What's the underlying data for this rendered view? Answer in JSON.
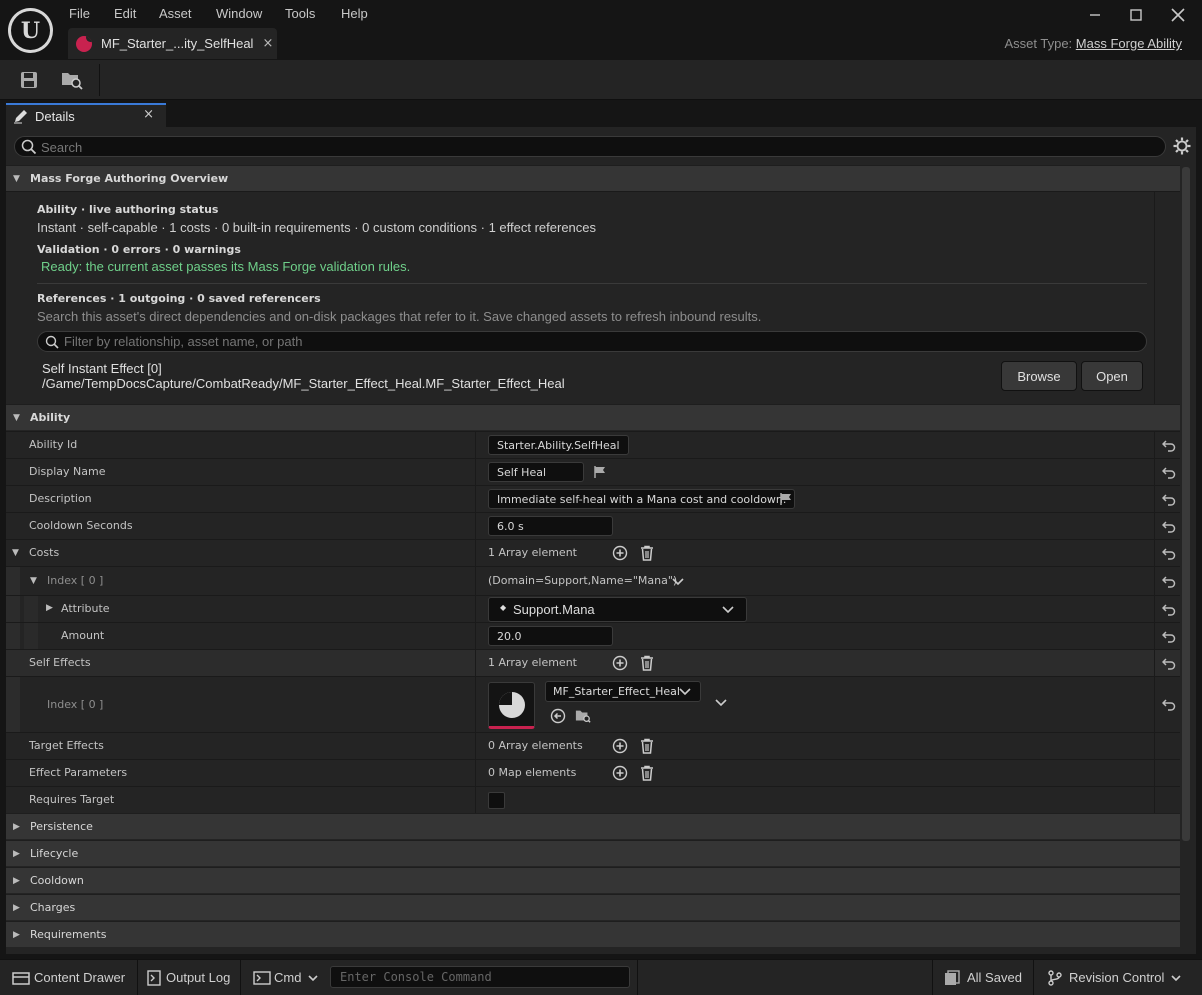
{
  "menu": {
    "file": "File",
    "edit": "Edit",
    "asset": "Asset",
    "window": "Window",
    "tools": "Tools",
    "help": "Help"
  },
  "document_tab": {
    "label": "MF_Starter_...ity_SelfHeal",
    "close": "×"
  },
  "asset_type": {
    "prefix": "Asset Type:",
    "value": "Mass Forge Ability"
  },
  "details_tab": {
    "label": "Details",
    "close": "×"
  },
  "search": {
    "placeholder": "Search"
  },
  "overview": {
    "category": "Mass Forge Authoring Overview",
    "ability_heading": "Ability · live authoring status",
    "ability_summary": "Instant · self-capable · 1 costs · 0 built-in requirements · 0 custom conditions · 1 effect references",
    "validation_heading": "Validation · 0 errors · 0 warnings",
    "validation_message": "Ready: the current asset passes its Mass Forge validation rules.",
    "references_heading": "References · 1 outgoing · 0 saved referencers",
    "references_help": "Search this asset's direct dependencies and on-disk packages that refer to it. Save changed assets to refresh inbound results.",
    "filter_placeholder": "Filter by relationship, asset name, or path",
    "ref_title": "Self Instant Effect [0]",
    "ref_path": "/Game/TempDocsCapture/CombatReady/MF_Starter_Effect_Heal.MF_Starter_Effect_Heal",
    "browse_label": "Browse",
    "open_label": "Open"
  },
  "ability": {
    "category": "Ability",
    "ability_id": {
      "name": "Ability Id",
      "value": "Starter.Ability.SelfHeal"
    },
    "display_name": {
      "name": "Display Name",
      "value": "Self Heal"
    },
    "description": {
      "name": "Description",
      "value": "Immediate self-heal with a Mana cost and cooldown."
    },
    "cooldown_seconds": {
      "name": "Cooldown Seconds",
      "value": "6.0 s"
    },
    "costs": {
      "name": "Costs",
      "value": "1 Array element"
    },
    "costs_index": {
      "name": "Index [ 0 ]",
      "value": "(Domain=Support,Name=\"Mana\")"
    },
    "attribute": {
      "name": "Attribute",
      "value": "Support.Mana",
      "bullet": "◆"
    },
    "amount": {
      "name": "Amount",
      "value": "20.0"
    },
    "self_effects": {
      "name": "Self Effects",
      "value": "1 Array element"
    },
    "self_effects_index": {
      "name": "Index [ 0 ]",
      "value": "MF_Starter_Effect_Heal"
    },
    "target_effects": {
      "name": "Target Effects",
      "value": "0 Array elements"
    },
    "effect_parameters": {
      "name": "Effect Parameters",
      "value": "0 Map elements"
    },
    "requires_target": {
      "name": "Requires Target"
    }
  },
  "collapsed_categories": [
    "Persistence",
    "Lifecycle",
    "Cooldown",
    "Charges",
    "Requirements"
  ],
  "statusbar": {
    "content_drawer": "Content Drawer",
    "output_log": "Output Log",
    "cmd": "Cmd",
    "console_placeholder": "Enter Console Command",
    "all_saved": "All Saved",
    "revision_control": "Revision Control"
  },
  "colors": {
    "accent": "#3a7ad8",
    "asset_pink": "#c8224f",
    "valid_green": "#6fd08a"
  }
}
